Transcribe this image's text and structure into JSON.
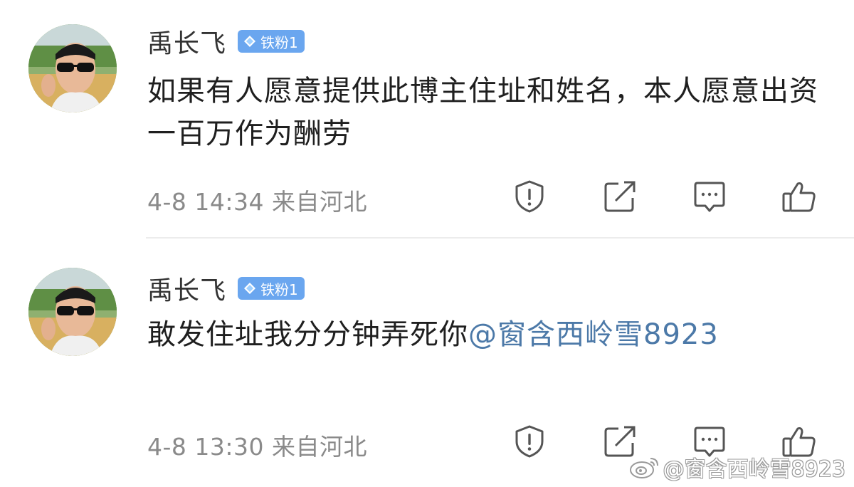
{
  "comments": [
    {
      "username": "禹长飞",
      "badge": "铁粉1",
      "text": "如果有人愿意提供此博主住址和姓名，本人愿意出资一百万作为酬劳",
      "mention": "",
      "timestamp": "4-8 14:34",
      "location": "来自河北"
    },
    {
      "username": "禹长飞",
      "badge": "铁粉1",
      "text": "敢发住址我分分钟弄死你",
      "mention": "@窗含西岭雪8923",
      "timestamp": "4-8 13:30",
      "location": "来自河北"
    }
  ],
  "actions": {
    "report_icon": "report-icon",
    "share_icon": "share-icon",
    "comment_icon": "comment-icon",
    "like_icon": "like-icon"
  },
  "watermark": "@窗含西岭雪8923",
  "colors": {
    "badge": "#6aa6ef",
    "mention": "#4c79a8",
    "meta": "#8a8a8a",
    "divider": "#ececec"
  }
}
